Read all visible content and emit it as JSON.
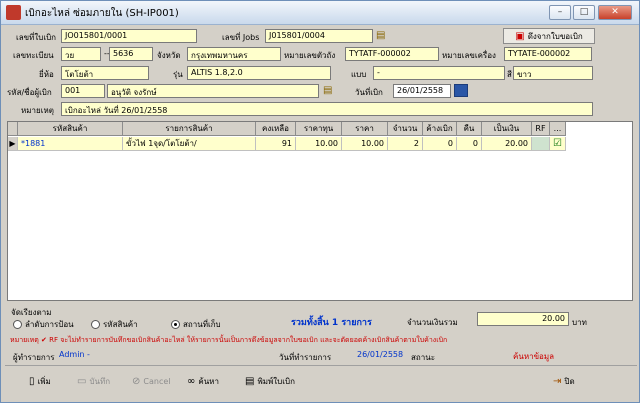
{
  "window": {
    "title": "เบิกอะไหล่ ซ่อมภายใน (SH-IP001)",
    "min": "–",
    "max": "□",
    "close": "✕"
  },
  "form": {
    "doc_label": "เลขที่ใบเบิก",
    "doc_value": "JO015801/0001",
    "jobs_label": "เลขที่ Jobs",
    "jobs_value": "J015801/0004",
    "copy_button": "ดึงจากใบขอเบิก",
    "reg_label": "เลขทะเบียน",
    "reg_prefix": "วย",
    "reg_dash": "--",
    "reg_no": "5636",
    "province_label": "จังหวัด",
    "province_value": "กรุงเทพมหานคร",
    "chassis_label": "หมายเลขตัวถัง",
    "chassis_value": "TYTATF-000002",
    "engine_label": "หมายเลขเครื่อง",
    "engine_value": "TYTATE-000002",
    "brand_label": "ยี่ห้อ",
    "brand_value": "โตโยต้า",
    "model_label": "รุ่น",
    "model_value": "ALTIS 1.8,2.0",
    "type_label": "แบบ",
    "type_dash": "-",
    "color_label": "สี",
    "color_value": "ขาว",
    "requester_label": "รหัส/ชื่อผู้เบิก",
    "requester_code": "001",
    "requester_name": "อนุวัติ จงรักษ์",
    "date_label": "วันที่เบิก",
    "date_value": "26/01/2558",
    "note_label": "หมายเหตุ",
    "note_value": "เบิกอะไหล่ วันที่ 26/01/2558"
  },
  "grid": {
    "headers": [
      "รหัสสินค้า",
      "รายการสินค้า",
      "คงเหลือ",
      "ราคาทุน",
      "ราคา",
      "จำนวน",
      "ค้างเบิก",
      "คืน",
      "เป็นเงิน",
      "RF",
      "..."
    ],
    "rows": [
      {
        "marker": "▶",
        "code": "*1881",
        "name": "ขั้วไฟ 1จุด/โตโยต้า/",
        "balance": "91",
        "cost": "10.00",
        "price": "10.00",
        "qty": "2",
        "pending": "0",
        "returned": "0",
        "amount": "20.00",
        "rf": "",
        "check": "☑"
      }
    ]
  },
  "sort": {
    "label": "จัดเรียงตาม",
    "opt1": "ลำดับการป้อน",
    "opt2": "รหัสสินค้า",
    "opt3": "สถานที่เก็บ",
    "selected": "สถานที่เก็บ"
  },
  "summary": {
    "total_items": "รวมทั้งสิ้น 1 รายการ",
    "total_label": "จำนวนเงินรวม",
    "total_value": "20.00",
    "unit": "บาท"
  },
  "notice": {
    "text": "หมายเหตุ ✔ RF จะไม่ทำรายการบันทึกขอเบิกสินค้าอะไหล่  ให้รายการนั้นเป็นการดึงข้อมูลจากใบขอเบิก และจะตัดยอดค้างเบิกสินค้าตามใบค้างเบิก"
  },
  "footer": {
    "maker_label": "ผู้ทำรายการ",
    "maker_value": "Admin -",
    "txdate_label": "วันที่ทำรายการ",
    "txdate_value": "26/01/2558",
    "status_label": "สถานะ",
    "status_value": "ค้นหาข้อมูล"
  },
  "toolbar": {
    "add": "เพิ่ม",
    "save": "บันทึก",
    "cancel": "Cancel",
    "search": "ค้นหา",
    "print": "พิมพ์ใบเบิก",
    "close": "ปิด"
  },
  "colors": {
    "field": "#ffffcc",
    "accent_blue": "#0033cc",
    "notice_red": "#cc0000",
    "status_red": "#cc0000"
  }
}
